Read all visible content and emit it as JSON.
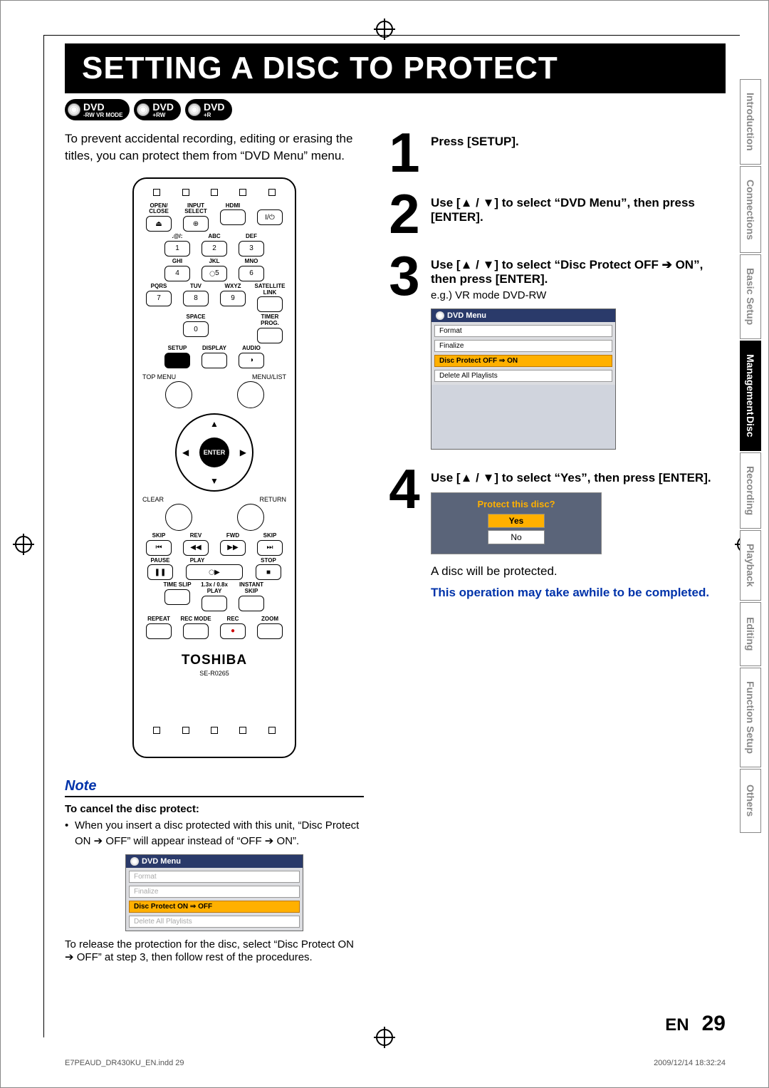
{
  "title": "SETTING A DISC TO PROTECT",
  "badges": [
    {
      "top": "DVD",
      "sub": "-RW VR MODE"
    },
    {
      "top": "DVD",
      "sub": "+RW"
    },
    {
      "top": "DVD",
      "sub": "+R"
    }
  ],
  "intro": "To prevent accidental recording, editing or erasing the titles, you can protect them from “DVD Menu” menu.",
  "remote": {
    "labels": {
      "open_close": "OPEN/\nCLOSE",
      "input_select": "INPUT\nSELECT",
      "hdmi": "HDMI",
      "power": "I/⏻",
      "sym": ".@/:",
      "abc": "ABC",
      "def": "DEF",
      "ghi": "GHI",
      "jkl": "JKL",
      "mno": "MNO",
      "pqrs": "PQRS",
      "tuv": "TUV",
      "wxyz": "WXYZ",
      "sat": "SATELLITE\nLINK",
      "space": "SPACE",
      "timer": "TIMER\nPROG.",
      "setup": "SETUP",
      "display": "DISPLAY",
      "audio": "AUDIO",
      "topmenu": "TOP MENU",
      "menulist": "MENU/LIST",
      "enter": "ENTER",
      "clear": "CLEAR",
      "return": "RETURN",
      "skip": "SKIP",
      "rev": "REV",
      "fwd": "FWD",
      "pause": "PAUSE",
      "play": "PLAY",
      "stop": "STOP",
      "timeslip": "TIME SLIP",
      "slowplay": "1.3x / 0.8x PLAY",
      "instant": "INSTANT SKIP",
      "repeat": "REPEAT",
      "recmode": "REC MODE",
      "rec": "REC",
      "zoom": "ZOOM"
    },
    "nums": [
      "1",
      "2",
      "3",
      "4",
      "5",
      "6",
      "7",
      "8",
      "9",
      "0"
    ],
    "brand": "TOSHIBA",
    "model": "SE-R0265"
  },
  "steps": [
    {
      "n": "1",
      "text": "Press [SETUP]."
    },
    {
      "n": "2",
      "text": "Use [▲ / ▼] to select “DVD Menu”, then press [ENTER]."
    },
    {
      "n": "3",
      "text": "Use [▲ / ▼] to select “Disc Protect OFF ➔ ON”, then press [ENTER].",
      "eg": "e.g.) VR mode DVD-RW"
    },
    {
      "n": "4",
      "text": "Use [▲ / ▼] to select “Yes”, then press [ENTER]."
    }
  ],
  "osd3": {
    "hdr": "DVD Menu",
    "rows": [
      "Format",
      "Finalize",
      "Disc Protect OFF ⇒ ON",
      "Delete All Playlists"
    ]
  },
  "osd4": {
    "q": "Protect this disc?",
    "yes": "Yes",
    "no": "No"
  },
  "step4_after": "A disc will be protected.",
  "tip": "This operation may take awhile to be completed.",
  "note": {
    "label": "Note",
    "cancel_hdr": "To cancel the disc protect:",
    "bullet1": "When you insert a disc protected with this unit, “Disc Protect ON ➔ OFF” will appear instead of “OFF ➔ ON”.",
    "osd": {
      "hdr": "DVD Menu",
      "rows": [
        "Format",
        "Finalize",
        "Disc Protect ON ⇒ OFF",
        "Delete All Playlists"
      ]
    },
    "after": "To release the protection for the disc, select “Disc Protect ON ➔ OFF” at step 3, then follow rest of the procedures."
  },
  "tabs": [
    "Introduction",
    "Connections",
    "Basic Setup",
    "Disc Management",
    "Recording",
    "Playback",
    "Editing",
    "Function Setup",
    "Others"
  ],
  "active_tab": "Disc Management",
  "footer": {
    "lang": "EN",
    "page": "29"
  },
  "imprint": {
    "left": "E7PEAUD_DR430KU_EN.indd   29",
    "right": "2009/12/14   18:32:24"
  }
}
